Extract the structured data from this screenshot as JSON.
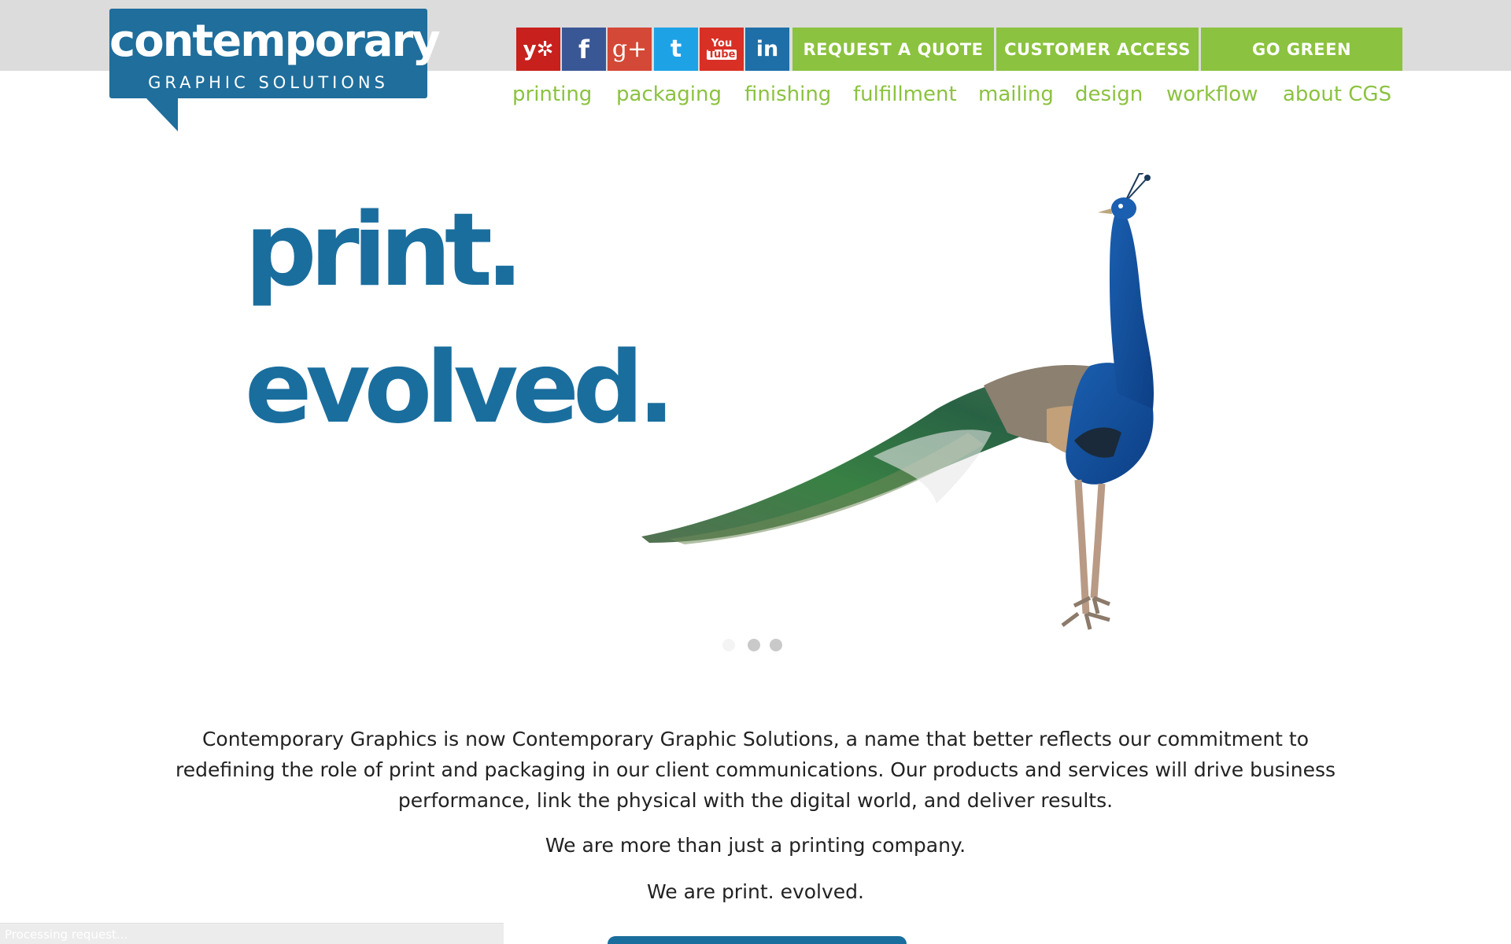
{
  "header": {
    "logo": {
      "name": "contemporary",
      "tagline": "GRAPHIC SOLUTIONS"
    },
    "social": [
      {
        "name": "yelp",
        "glyph": "y✲"
      },
      {
        "name": "facebook",
        "glyph": "f"
      },
      {
        "name": "google-plus",
        "glyph": "g+"
      },
      {
        "name": "twitter",
        "glyph": "t"
      },
      {
        "name": "youtube",
        "glyph_top": "You",
        "glyph_bottom": "Tube"
      },
      {
        "name": "linkedin",
        "glyph": "in"
      }
    ],
    "buttons": {
      "quote": "REQUEST A QUOTE",
      "access": "CUSTOMER ACCESS",
      "green": "GO GREEN"
    },
    "nav": [
      "printing",
      "packaging",
      "finishing",
      "fulfillment",
      "mailing",
      "design",
      "workflow",
      "about CGS"
    ]
  },
  "hero": {
    "line1": "print.",
    "line2": "evolved.",
    "image": "peacock",
    "slides": 3,
    "active_slide": 1
  },
  "intro": {
    "paragraph": "Contemporary Graphics is now Contemporary Graphic Solutions, a name that better reflects our commitment to redefining the role of print and packaging in our client communications. Our products and services will drive business performance, link the physical with the digital world, and deliver results.",
    "line2": "We are more than just a printing company.",
    "line3": "We are print. evolved."
  },
  "status_bar": "Processing request...",
  "colors": {
    "brand_blue": "#1a6e9e",
    "accent_green": "#8bc23f",
    "top_band": "#dcdcdc"
  }
}
